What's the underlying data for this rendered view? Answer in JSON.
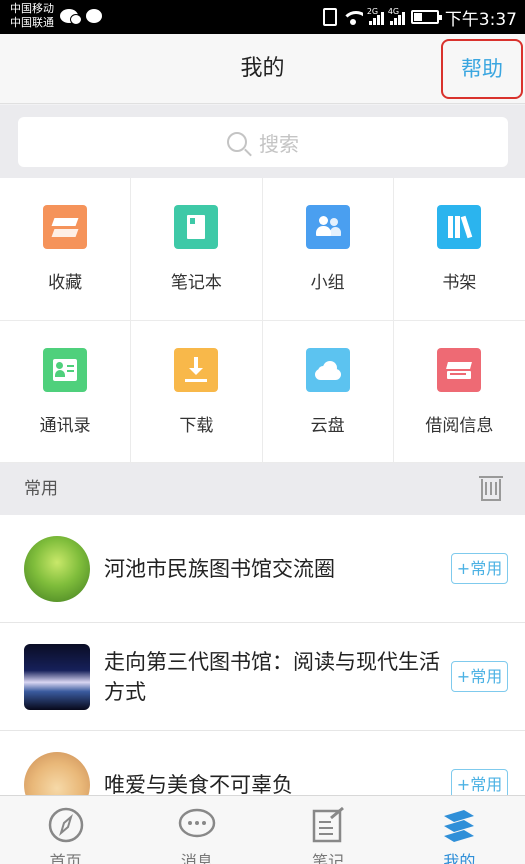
{
  "status_bar": {
    "carrier_1": "中国移动",
    "carrier_2": "中国联通",
    "sig1_tag": "2G",
    "sig2_tag": "4G",
    "time": "下午3:37"
  },
  "header": {
    "title": "我的",
    "help_label": "帮助"
  },
  "search": {
    "placeholder": "搜索"
  },
  "grid_items": [
    {
      "label": "收藏",
      "icon": "favorites-icon",
      "color": "#f5935a"
    },
    {
      "label": "笔记本",
      "icon": "notebook-icon",
      "color": "#3ec9a7"
    },
    {
      "label": "小组",
      "icon": "group-icon",
      "color": "#4a9ff0"
    },
    {
      "label": "书架",
      "icon": "bookshelf-icon",
      "color": "#2bb4ee"
    },
    {
      "label": "通讯录",
      "icon": "contacts-icon",
      "color": "#4fd07c"
    },
    {
      "label": "下载",
      "icon": "download-icon",
      "color": "#f8b84a"
    },
    {
      "label": "云盘",
      "icon": "cloud-icon",
      "color": "#5cc3f0"
    },
    {
      "label": "借阅信息",
      "icon": "borrow-info-icon",
      "color": "#ee6a74"
    }
  ],
  "section": {
    "label": "常用"
  },
  "list_items": [
    {
      "title": "河池市民族图书馆交流圈",
      "button": "+常用"
    },
    {
      "title": "走向第三代图书馆：阅读与现代生活方式",
      "button": "+常用"
    },
    {
      "title": "唯爱与美食不可辜负",
      "button": "+常用"
    }
  ],
  "tabs": [
    {
      "label": "首页",
      "icon": "compass-icon"
    },
    {
      "label": "消息",
      "icon": "message-icon"
    },
    {
      "label": "笔记",
      "icon": "note-icon"
    },
    {
      "label": "我的",
      "icon": "profile-layers-icon",
      "active": true
    }
  ],
  "colors": {
    "accent": "#3aa6e0",
    "highlight_border": "#d9322d"
  }
}
